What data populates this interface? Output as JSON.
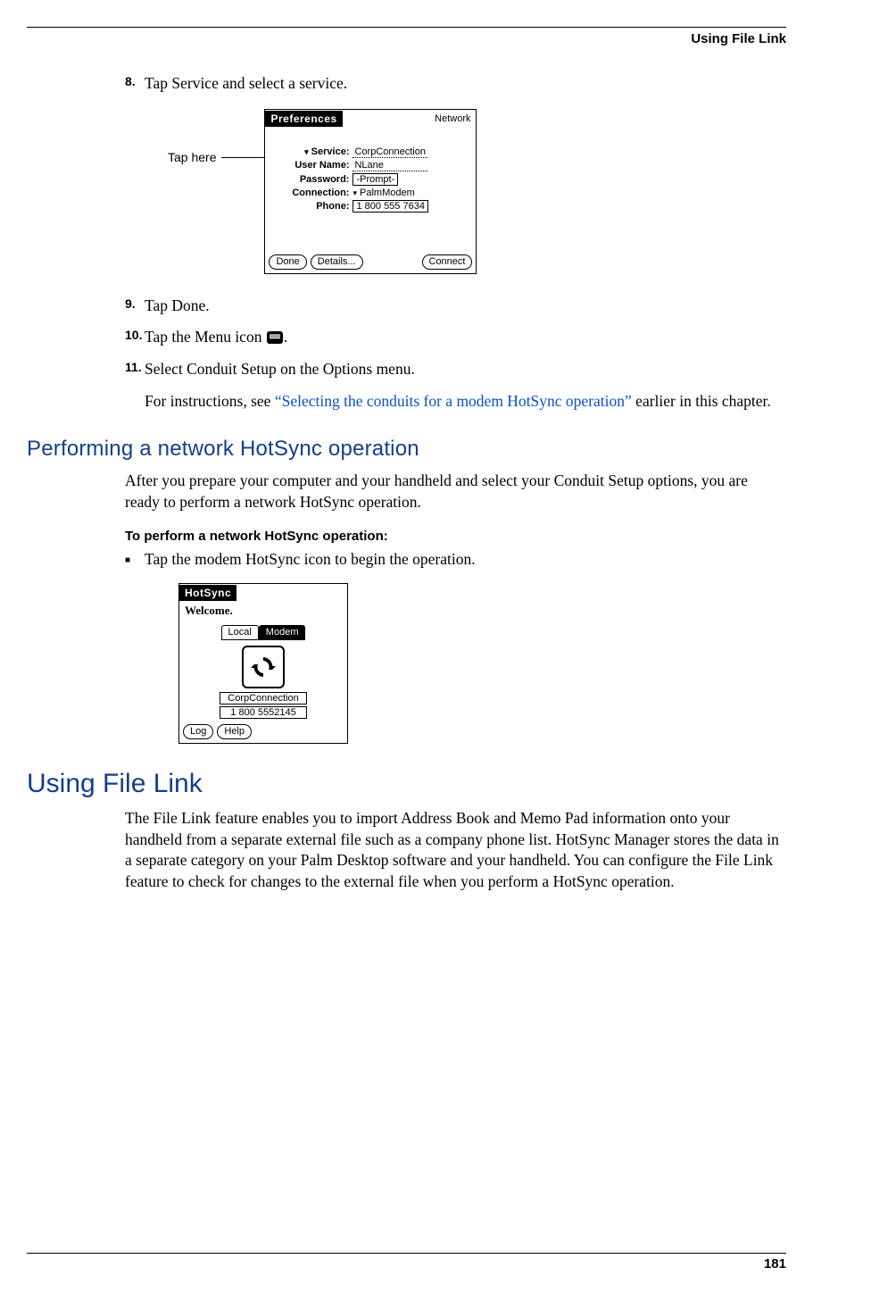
{
  "header": {
    "running_head": "Using File Link"
  },
  "steps": {
    "s8": {
      "num": "8.",
      "text": "Tap Service and select a service."
    },
    "s9": {
      "num": "9.",
      "text": "Tap Done."
    },
    "s10": {
      "num": "10.",
      "text_a": "Tap the Menu icon ",
      "text_b": "."
    },
    "s11": {
      "num": "11.",
      "text": "Select Conduit Setup on the Options menu."
    },
    "s11_sub_a": "For instructions, see ",
    "s11_link": "“Selecting the conduits for a modem HotSync operation”",
    "s11_sub_b": " earlier in this chapter."
  },
  "callout": {
    "tap_here": "Tap here"
  },
  "prefs": {
    "title": "Preferences",
    "category": "Network",
    "service_label": "Service:",
    "service_value": "CorpConnection",
    "user_label": "User Name:",
    "user_value": "NLane",
    "pwd_label": "Password:",
    "pwd_value": "-Prompt-",
    "conn_label": "Connection:",
    "conn_value": "PalmModem",
    "phone_label": "Phone:",
    "phone_value": "1 800 555 7634",
    "btn_done": "Done",
    "btn_details": "Details...",
    "btn_connect": "Connect"
  },
  "section1": {
    "heading": "Performing a network HotSync operation",
    "para": "After you prepare your computer and your handheld and select your Conduit Setup options, you are ready to perform a network HotSync operation.",
    "task_head": "To perform a network HotSync operation:",
    "bullet": "Tap the modem HotSync icon to begin the operation."
  },
  "hotsync": {
    "title": "HotSync",
    "welcome": "Welcome.",
    "tab_local": "Local",
    "tab_modem": "Modem",
    "conn": "CorpConnection",
    "phone": "1 800 5552145",
    "btn_log": "Log",
    "btn_help": "Help"
  },
  "section2": {
    "heading": "Using File Link",
    "para": "The File Link feature enables you to import Address Book and Memo Pad information onto your handheld from a separate external file such as a company phone list. HotSync Manager stores the data in a separate category on your Palm Desktop software and your handheld. You can configure the File Link feature to check for changes to the external file when you perform a HotSync operation."
  },
  "footer": {
    "page": "181"
  }
}
